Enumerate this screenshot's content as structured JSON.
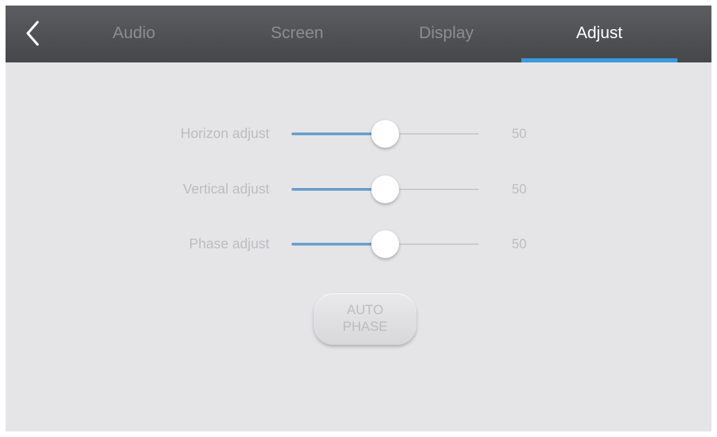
{
  "header": {
    "tabs": [
      {
        "label": "Audio",
        "active": false
      },
      {
        "label": "Screen",
        "active": false
      },
      {
        "label": "Display",
        "active": false
      },
      {
        "label": "Adjust",
        "active": true
      }
    ],
    "active_tab_color": "#3a9ad9",
    "back_icon": "chevron-left-icon"
  },
  "adjust": {
    "rows": [
      {
        "label": "Horizon adjust",
        "value": "50",
        "level": 50,
        "max": 100
      },
      {
        "label": "Vertical adjust",
        "value": "50",
        "level": 50,
        "max": 100
      },
      {
        "label": "Phase adjust",
        "value": "50",
        "level": 50,
        "max": 100
      }
    ],
    "auto_phase_button": {
      "line1": "AUTO",
      "line2": "PHASE"
    }
  },
  "colors": {
    "background": "#e5e5e8",
    "topbar": "#4f5054",
    "slider_fill": "#6b9fcb"
  }
}
